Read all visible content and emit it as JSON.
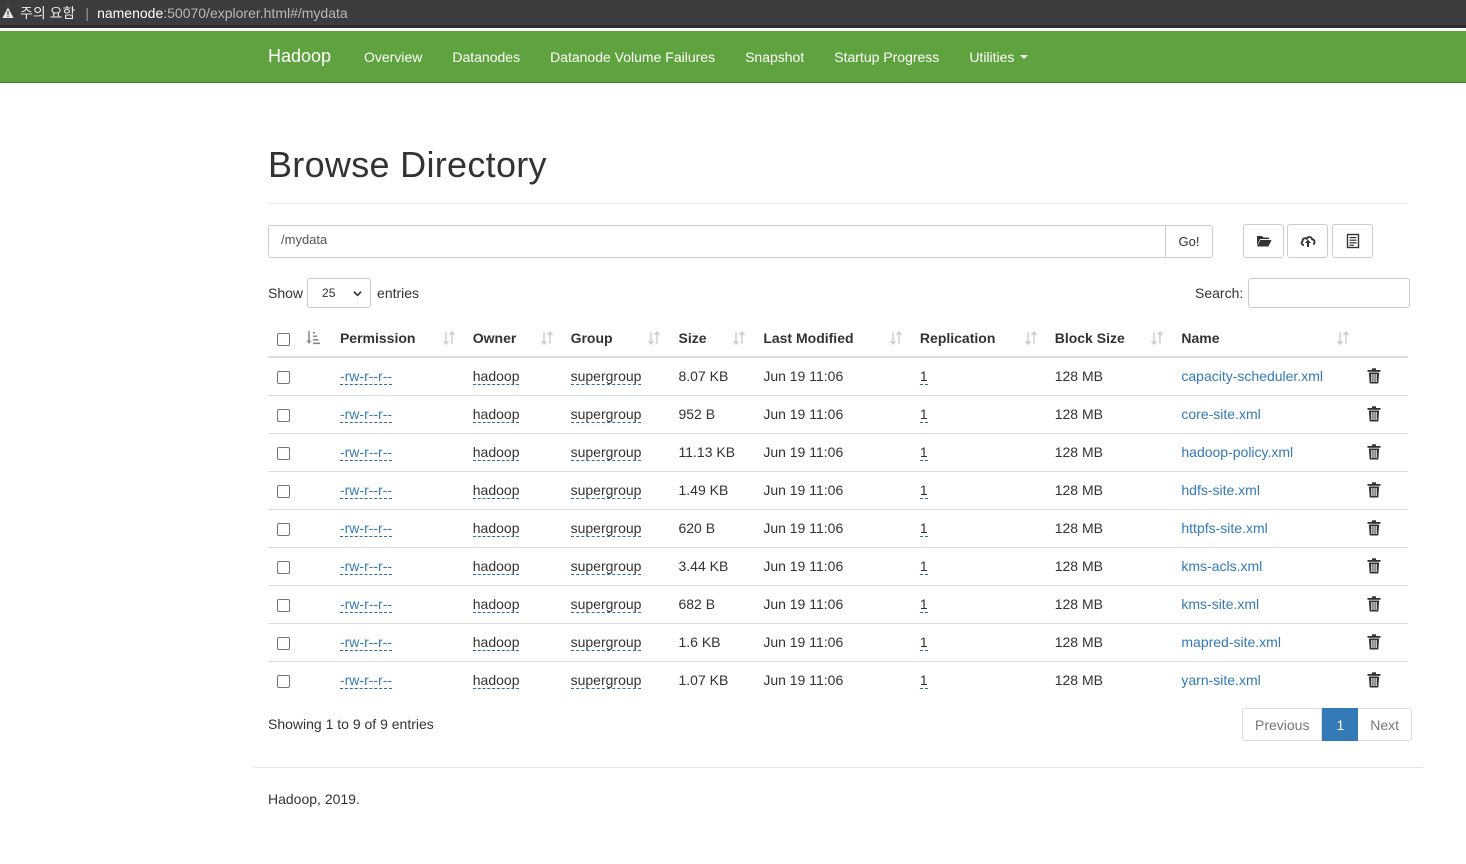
{
  "browser": {
    "warning_label": "주의 요함",
    "url_host": "namenode",
    "url_path": ":50070/explorer.html#/mydata"
  },
  "navbar": {
    "brand": "Hadoop",
    "items": [
      "Overview",
      "Datanodes",
      "Datanode Volume Failures",
      "Snapshot",
      "Startup Progress",
      "Utilities"
    ]
  },
  "page": {
    "title": "Browse Directory",
    "path_value": "/mydata",
    "go_label": "Go!",
    "show_label": "Show",
    "entries_label": "entries",
    "page_length": "25",
    "search_label": "Search:",
    "info": "Showing 1 to 9 of 9 entries",
    "prev_label": "Previous",
    "current_page": "1",
    "next_label": "Next",
    "footer": "Hadoop, 2019."
  },
  "table": {
    "headers": [
      "Permission",
      "Owner",
      "Group",
      "Size",
      "Last Modified",
      "Replication",
      "Block Size",
      "Name"
    ],
    "rows": [
      {
        "permission": "-rw-r--r--",
        "owner": "hadoop",
        "group": "supergroup",
        "size": "8.07 KB",
        "modified": "Jun 19 11:06",
        "replication": "1",
        "block": "128 MB",
        "name": "capacity-scheduler.xml"
      },
      {
        "permission": "-rw-r--r--",
        "owner": "hadoop",
        "group": "supergroup",
        "size": "952 B",
        "modified": "Jun 19 11:06",
        "replication": "1",
        "block": "128 MB",
        "name": "core-site.xml"
      },
      {
        "permission": "-rw-r--r--",
        "owner": "hadoop",
        "group": "supergroup",
        "size": "11.13 KB",
        "modified": "Jun 19 11:06",
        "replication": "1",
        "block": "128 MB",
        "name": "hadoop-policy.xml"
      },
      {
        "permission": "-rw-r--r--",
        "owner": "hadoop",
        "group": "supergroup",
        "size": "1.49 KB",
        "modified": "Jun 19 11:06",
        "replication": "1",
        "block": "128 MB",
        "name": "hdfs-site.xml"
      },
      {
        "permission": "-rw-r--r--",
        "owner": "hadoop",
        "group": "supergroup",
        "size": "620 B",
        "modified": "Jun 19 11:06",
        "replication": "1",
        "block": "128 MB",
        "name": "httpfs-site.xml"
      },
      {
        "permission": "-rw-r--r--",
        "owner": "hadoop",
        "group": "supergroup",
        "size": "3.44 KB",
        "modified": "Jun 19 11:06",
        "replication": "1",
        "block": "128 MB",
        "name": "kms-acls.xml"
      },
      {
        "permission": "-rw-r--r--",
        "owner": "hadoop",
        "group": "supergroup",
        "size": "682 B",
        "modified": "Jun 19 11:06",
        "replication": "1",
        "block": "128 MB",
        "name": "kms-site.xml"
      },
      {
        "permission": "-rw-r--r--",
        "owner": "hadoop",
        "group": "supergroup",
        "size": "1.6 KB",
        "modified": "Jun 19 11:06",
        "replication": "1",
        "block": "128 MB",
        "name": "mapred-site.xml"
      },
      {
        "permission": "-rw-r--r--",
        "owner": "hadoop",
        "group": "supergroup",
        "size": "1.07 KB",
        "modified": "Jun 19 11:06",
        "replication": "1",
        "block": "128 MB",
        "name": "yarn-site.xml"
      }
    ]
  },
  "colors": {
    "navbar": "#5fa33e",
    "link": "#337ab7",
    "active_page": "#337ab7"
  }
}
